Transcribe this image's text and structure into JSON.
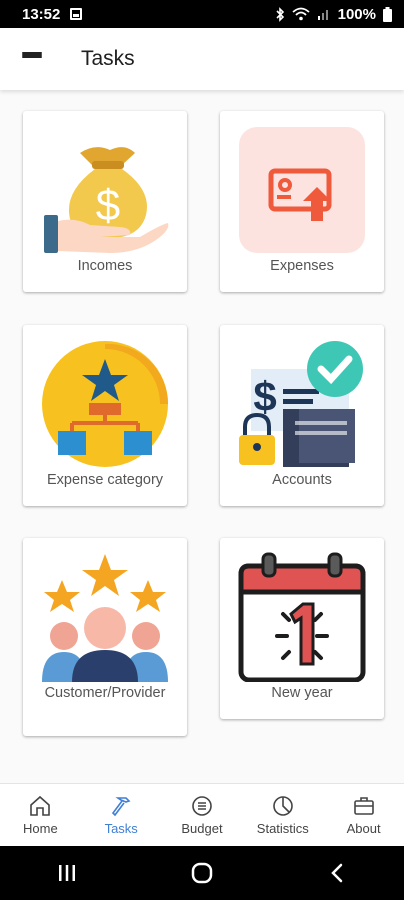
{
  "status_bar": {
    "time": "13:52",
    "battery": "100%"
  },
  "app_bar": {
    "title": "Tasks"
  },
  "tiles": [
    {
      "label": "Incomes",
      "icon": "money-bag-hand-icon"
    },
    {
      "label": "Expenses",
      "icon": "expense-card-upload-icon"
    },
    {
      "label": "Expense category",
      "icon": "category-hierarchy-star-icon"
    },
    {
      "label": "Accounts",
      "icon": "account-document-check-icon"
    },
    {
      "label": "Customer/Provider",
      "icon": "people-stars-icon"
    },
    {
      "label": "New year",
      "icon": "calendar-one-icon"
    }
  ],
  "bottom_nav": {
    "active": "Tasks",
    "items": [
      {
        "label": "Home",
        "icon": "home-icon"
      },
      {
        "label": "Tasks",
        "icon": "hammer-icon"
      },
      {
        "label": "Budget",
        "icon": "list-circle-icon"
      },
      {
        "label": "Statistics",
        "icon": "pie-chart-icon"
      },
      {
        "label": "About",
        "icon": "briefcase-icon"
      }
    ]
  },
  "colors": {
    "accent": "#3f7fd6",
    "expense_bg": "#fde3df",
    "expense_icon": "#f05a3c",
    "gold": "#f2c94c",
    "calendar_red": "#e05353"
  }
}
